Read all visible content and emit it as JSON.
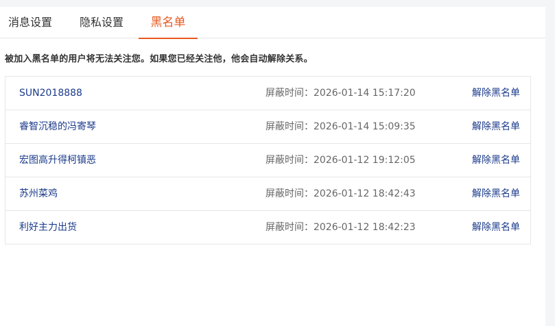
{
  "tabs": [
    {
      "label": "消息设置"
    },
    {
      "label": "隐私设置"
    },
    {
      "label": "黑名单"
    }
  ],
  "active_tab_color": "#e8571e",
  "notice": "被加入黑名单的用户将无法关注您。如果您已经关注他，他会自动解除关系。",
  "time_label": "屏蔽时间：",
  "action_label": "解除黑名单",
  "blacklist": [
    {
      "user": "SUN2018888",
      "time": "2026-01-14 15:17:20"
    },
    {
      "user": "睿智沉稳的冯寄琴",
      "time": "2026-01-14 15:09:35"
    },
    {
      "user": "宏图高升得柯镇恶",
      "time": "2026-01-12 19:12:05"
    },
    {
      "user": "苏州菜鸡",
      "time": "2026-01-12 18:42:43"
    },
    {
      "user": "利好主力出货",
      "time": "2026-01-12 18:42:23"
    }
  ]
}
